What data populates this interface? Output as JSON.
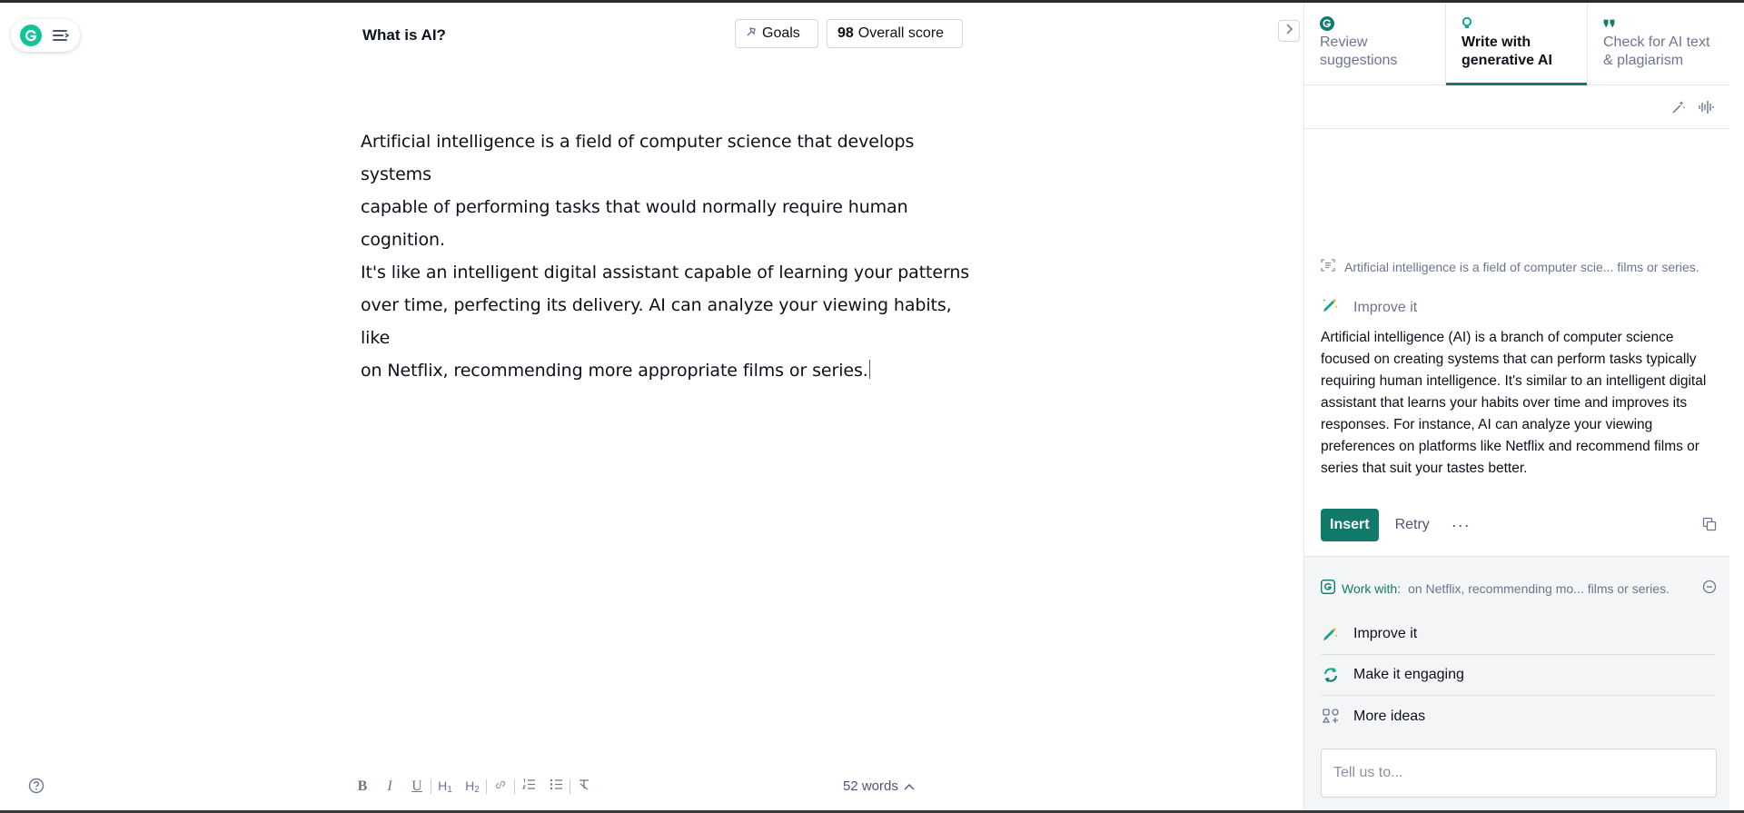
{
  "header": {
    "doc_title": "What is AI?",
    "goals_label": "Goals",
    "score_value": "98",
    "score_label": "Overall score"
  },
  "editor": {
    "lines": [
      "Artificial intelligence is a field of computer science that develops systems",
      "capable of performing tasks that would normally require human cognition.",
      "It's like an intelligent digital assistant capable of learning your patterns",
      "over time, perfecting its delivery. AI can analyze your viewing habits, like",
      "on Netflix, recommending more appropriate films or series."
    ]
  },
  "toolbar": {
    "bold": "B",
    "italic": "I",
    "underline": "U",
    "h1": "H",
    "h1_sub": "1",
    "h2": "H",
    "h2_sub": "2",
    "word_count": "52 words"
  },
  "panel": {
    "tabs": [
      {
        "label": "Review suggestions",
        "icon": "grammarly-icon"
      },
      {
        "label": "Write with generative AI",
        "icon": "lightbulb-icon"
      },
      {
        "label": "Check for AI text & plagiarism",
        "icon": "quote-icon"
      }
    ],
    "context": "Artificial intelligence is a field of computer scie... films or series.",
    "improve_heading": "Improve it",
    "result": "Artificial intelligence (AI) is a branch of computer science focused on creating systems that can perform tasks typically requiring human intelligence. It's similar to an intelligent digital assistant that learns your habits over time and improves its responses. For instance, AI can analyze your viewing preferences on platforms like Netflix and recommend films or series that suit your tastes better.",
    "insert_label": "Insert",
    "retry_label": "Retry",
    "more_label": "···",
    "work_label": "Work with:",
    "work_snippet": "on Netflix, recommending mo... films or series.",
    "suggestions": [
      {
        "label": "Improve it",
        "icon": "pencil-sparkle-icon"
      },
      {
        "label": "Make it engaging",
        "icon": "refresh-icon"
      },
      {
        "label": "More ideas",
        "icon": "grid-shapes-icon"
      }
    ],
    "prompt_placeholder": "Tell us to..."
  },
  "colors": {
    "accent": "#107a6b",
    "brand": "#15c39a",
    "text": "#0e101a",
    "muted": "#6d758d"
  }
}
